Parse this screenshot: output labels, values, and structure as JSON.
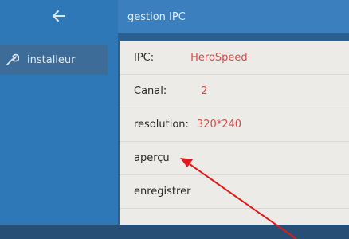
{
  "header": {
    "title": "gestion IPC"
  },
  "sidebar": {
    "back_icon": "left-arrow-icon",
    "items": [
      {
        "label": "installeur",
        "icon": "wrench-icon"
      }
    ]
  },
  "panel": {
    "rows": [
      {
        "key": "IPC:",
        "value": "HeroSpeed"
      },
      {
        "key": "Canal:",
        "value": "2"
      },
      {
        "key": "resolution:",
        "value": "320*240"
      },
      {
        "key": "aperçu",
        "value": ""
      },
      {
        "key": "enregistrer",
        "value": ""
      }
    ]
  },
  "colors": {
    "sidebar": "#2f78b8",
    "header": "#3c7fbe",
    "panel": "#ecebe8",
    "value_text": "#d34b48",
    "annotation_arrow": "#e01a1a"
  }
}
